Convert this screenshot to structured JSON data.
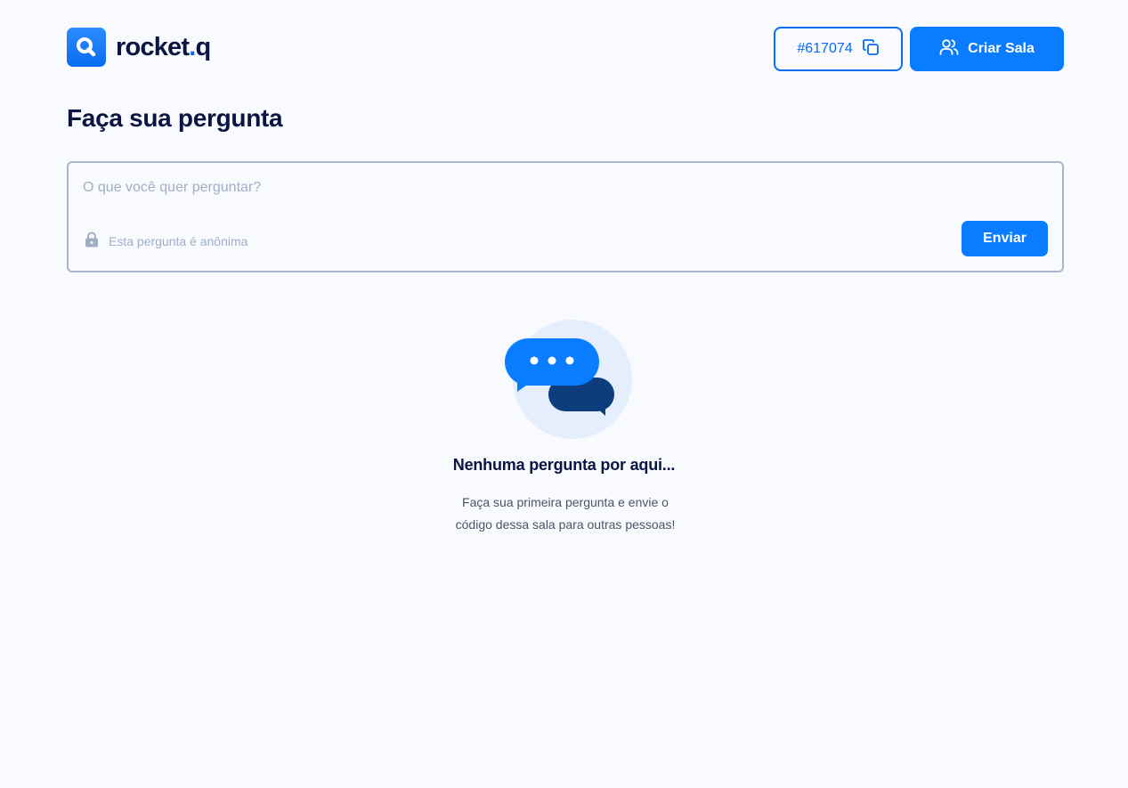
{
  "brand": {
    "name_main": "rocket",
    "name_dot": ".",
    "name_suffix": "q",
    "logo_icon": "magnifier-logo-icon",
    "accent_color": "#0a7cff",
    "title_color": "#0b1543"
  },
  "header": {
    "room_code": "#617074",
    "copy_icon": "copy-icon",
    "create_room_label": "Criar Sala",
    "create_room_icon": "users-icon"
  },
  "main": {
    "title": "Faça sua pergunta",
    "question_placeholder": "O que você quer perguntar?",
    "question_value": "",
    "anonymous_label": "Esta pergunta é anônima",
    "anonymous_icon": "lock-icon",
    "send_label": "Enviar"
  },
  "empty_state": {
    "icon": "chat-bubbles-icon",
    "title": "Nenhuma pergunta por aqui...",
    "description_line1": "Faça sua primeira pergunta e envie o",
    "description_line2": "código dessa sala para outras pessoas!"
  }
}
